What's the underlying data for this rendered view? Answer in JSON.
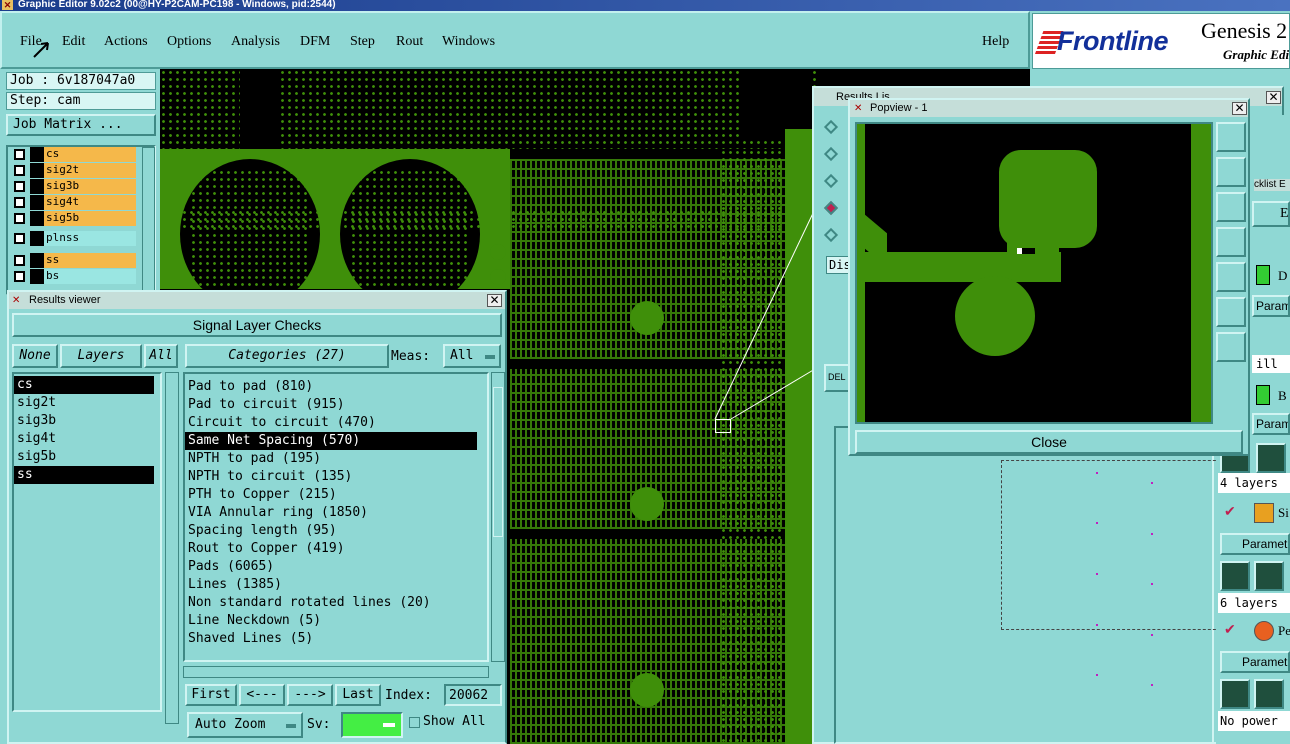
{
  "window": {
    "title": "Graphic Editor 9.02c2 (00@HY-P2CAM-PC198 - Windows, pid:2544)"
  },
  "menu": {
    "items": [
      "File",
      "Edit",
      "Actions",
      "Options",
      "Analysis",
      "DFM",
      "Step",
      "Rout",
      "Windows"
    ],
    "help": "Help"
  },
  "logo": {
    "brand": "Frontline",
    "product": "Genesis 2",
    "sub": "Graphic Editor"
  },
  "job": {
    "job_label": "Job : 6v187047a0",
    "step_label": "Step: cam",
    "matrix_button": "Job Matrix ..."
  },
  "layers": [
    {
      "name": "cs",
      "color": "#f5b84a"
    },
    {
      "name": "sig2t",
      "color": "#f5b84a"
    },
    {
      "name": "sig3b",
      "color": "#f5b84a"
    },
    {
      "name": "sig4t",
      "color": "#f5b84a"
    },
    {
      "name": "sig5b",
      "color": "#f5b84a"
    },
    {
      "name": "plnss",
      "color": "#9ae6e2"
    },
    {
      "name": "ss",
      "color": "#f5b84a"
    },
    {
      "name": "bs",
      "color": "#9ae6e2"
    }
  ],
  "results_viewer": {
    "title": "Results viewer",
    "section": "Signal Layer Checks",
    "none_btn": "None",
    "layers_btn": "Layers",
    "all_btn": "All",
    "layer_list": [
      "cs",
      "sig2t",
      "sig3b",
      "sig4t",
      "sig5b",
      "ss"
    ],
    "categories_label": "Categories (27)",
    "meas_label": "Meas:",
    "meas_value": "All",
    "categories": [
      "Pad to pad (810)",
      "Pad to circuit (915)",
      "Circuit to circuit (470)",
      "Same Net Spacing (570)",
      "NPTH to pad (195)",
      "NPTH to circuit (135)",
      "PTH to Copper (215)",
      "VIA Annular ring (1850)",
      "Spacing length (95)",
      "Rout to Copper (419)",
      "Pads (6065)",
      "Lines (1385)",
      "Non standard rotated lines (20)",
      "Line Neckdown (5)",
      "Shaved Lines (5)"
    ],
    "nav": {
      "first": "First",
      "prev": "<---",
      "next": "--->",
      "last": "Last",
      "index_label": "Index:",
      "index_value": "20062"
    },
    "zoom_mode": "Auto Zoom",
    "sv_label": "Sv:",
    "show_all": "Show All"
  },
  "popview": {
    "title": "Popview - 1",
    "close_button": "Close"
  },
  "behind": {
    "title_fragment": "Results Lis",
    "disp": "Dis",
    "del": "DEL"
  },
  "checklist": {
    "title_fragment": "cklist E",
    "edit": "Edit",
    "param1": "Paramet",
    "drill": "ill",
    "layers4": "4 layers",
    "param2": "Paramet",
    "si": "Si",
    "param3": "Paramet",
    "layers6": "6 layers",
    "pe": "Pe",
    "param4": "Paramet",
    "no_power": "No power",
    "d": "D",
    "b": "B"
  }
}
